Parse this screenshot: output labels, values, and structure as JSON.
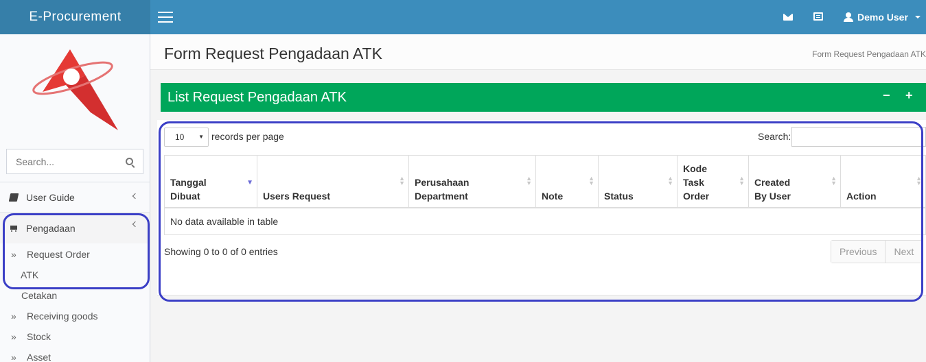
{
  "header": {
    "brand": "E-Procurement",
    "user_name": "Demo User"
  },
  "sidebar": {
    "search_placeholder": "Search...",
    "items": [
      {
        "label": "User Guide"
      },
      {
        "label": "Pengadaan"
      }
    ],
    "subitems": {
      "request_order_line1": "Request Order",
      "request_order_line2": "ATK",
      "cetakan": "Cetakan",
      "receiving": "Receiving goods",
      "stock": "Stock",
      "asset": "Asset"
    }
  },
  "page": {
    "title": "Form Request Pengadaan ATK",
    "breadcrumb": "Form Request Pengadaan ATK"
  },
  "box": {
    "title": "List Request Pengadaan ATK",
    "collapse": "−",
    "expand": "+"
  },
  "datatable": {
    "length_value": "10",
    "length_label": "records per page",
    "search_label": "Search:",
    "columns": [
      {
        "l1": "Tanggal",
        "l2": "Dibuat"
      },
      {
        "l1": "Users Request"
      },
      {
        "l1": "Perusahaan",
        "l2": "Department"
      },
      {
        "l1": "Note"
      },
      {
        "l1": "Status"
      },
      {
        "l1": "Kode",
        "l2": "Task",
        "l3": "Order"
      },
      {
        "l1": "Created",
        "l2": "By User"
      },
      {
        "l1": "Action"
      }
    ],
    "empty_text": "No data available in table",
    "info": "Showing 0 to 0 of 0 entries",
    "prev": "Previous",
    "next": "Next"
  }
}
